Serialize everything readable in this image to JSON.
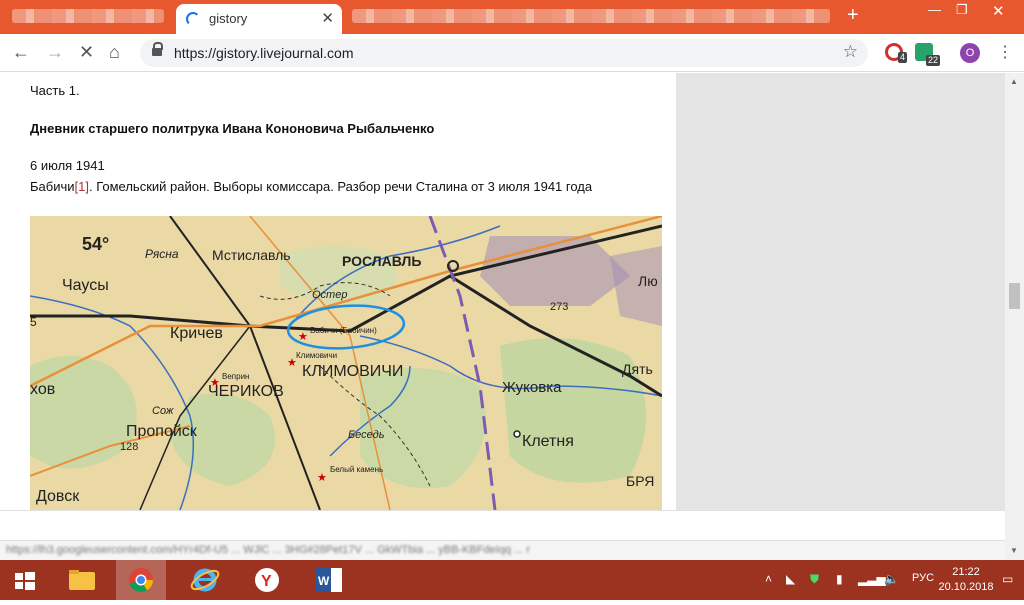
{
  "browser": {
    "active_tab_title": "gistory",
    "url": "https://gistory.livejournal.com",
    "new_tab_glyph": "+",
    "extension_badges": [
      "4",
      "22"
    ],
    "profile_initial": "O"
  },
  "article": {
    "part": "Часть 1.",
    "heading": "Дневник старшего политрука Ивана Кононовича Рыбальченко",
    "date": "6 июля 1941",
    "subtitle_prefix": "Бабичи",
    "footnote_ref": "[1]",
    "subtitle_rest": ". Гомельский район. Выборы комиссара. Разбор речи Сталина от 3 июля 1941 года"
  },
  "map": {
    "latitude_label": "54°",
    "labels": {
      "ryasna": "Рясна",
      "mstislavl": "Мстиславль",
      "roslavl": "РОСЛАВЛЬ",
      "chausy": "Чаусы",
      "krichev": "Кричев",
      "babichi": "Бабичи (Бабичин)",
      "klimovichi_small": "Климовичи",
      "klimovichi": "КЛИМОВИЧИ",
      "zhukovka": "Жуковка",
      "dyat": "Дять",
      "verpin": "Веприн",
      "cherikov": "ЧЕРИКОВ",
      "propoisk": "Пропойск",
      "khov": "хов",
      "klyetnya": "Клетня",
      "bryansk_part": "БРЯ",
      "belyi_kamen": "Белый камень",
      "dovsk": "Довск",
      "lyu": "Лю",
      "elev_273": "273",
      "elev_128": "128",
      "sozh": "Сож",
      "besed": "Беседь",
      "ostyor": "Остер",
      "edge_5": "5"
    }
  },
  "statusbar": {
    "text": "https://lh3.googleusercontent.com/HYr4Df-U5 ... WJlC ... 3HG#28Pet17V ... GkWTbia ... yBB-KBFdeIqq ... r"
  },
  "taskbar": {
    "lang": "РУС",
    "time": "21:22",
    "date": "20.10.2018"
  },
  "colors": {
    "tabstrip": "#e8582f",
    "taskbar": "#9c3320",
    "link": "#aa3333",
    "annotation": "#1e90e0"
  }
}
